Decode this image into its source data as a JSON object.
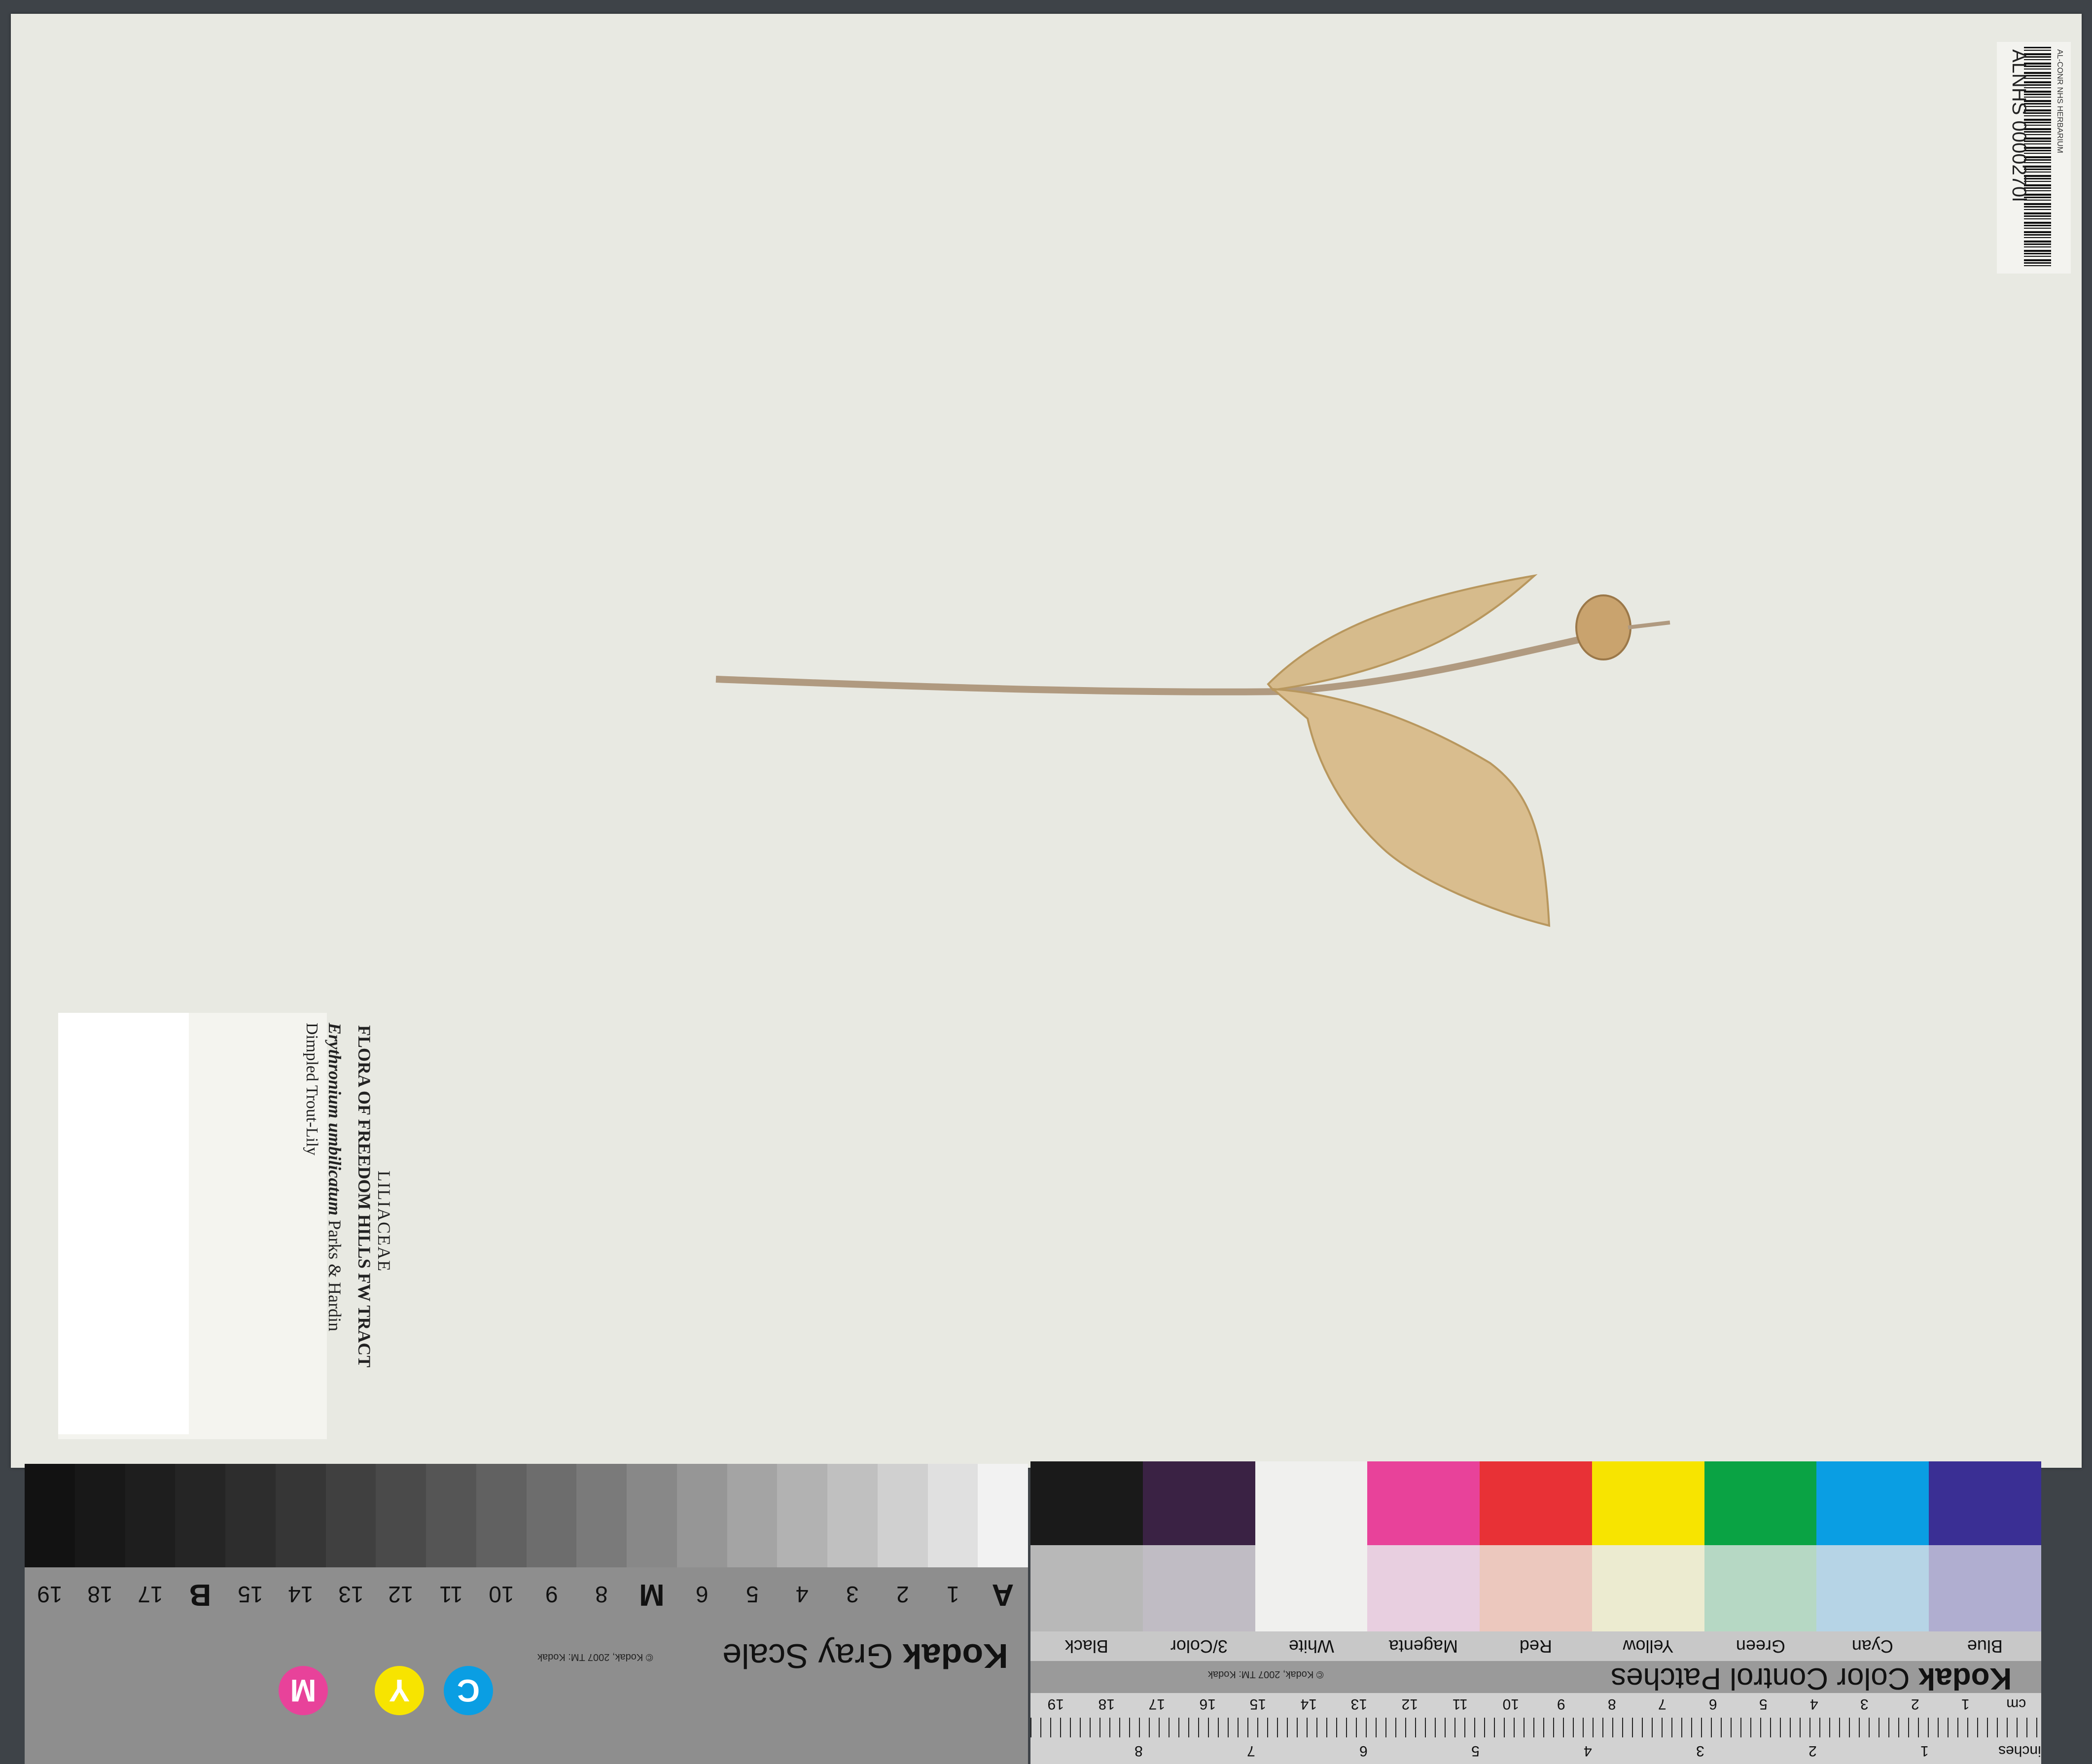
{
  "barcode": {
    "code": "ALNHS 0000270l",
    "institution": "AL-CONR NHS HERBARIUM"
  },
  "label": {
    "family": "LILIACEAE",
    "flora": "FLORA OF FREEDOM HILLS FW TRACT",
    "scientific_name": "Erythronium umbilicatum",
    "authority": "Parks & Hardin",
    "common_name": "Dimpled Trout-Lily"
  },
  "gray_scale": {
    "brand": "Kodak",
    "title": "Gray Scale",
    "copyright": "© Kodak, 2007 TM: Kodak",
    "steps": [
      "A",
      "1",
      "2",
      "3",
      "4",
      "5",
      "6",
      "M",
      "8",
      "9",
      "10",
      "11",
      "12",
      "13",
      "14",
      "15",
      "B",
      "17",
      "18",
      "19"
    ],
    "cym": [
      "C",
      "Y",
      "M"
    ]
  },
  "color_patches": {
    "brand": "Kodak",
    "title": "Color Control Patches",
    "copyright": "© Kodak, 2007 TM: Kodak",
    "names": [
      "Blue",
      "Cyan",
      "Green",
      "Yellow",
      "Red",
      "Magenta",
      "White",
      "3/Color",
      "Black"
    ],
    "cm_label": "cm",
    "inches_label": "inches",
    "cm_numbers": [
      "1",
      "2",
      "3",
      "4",
      "5",
      "6",
      "7",
      "8",
      "9",
      "10",
      "11",
      "12",
      "13",
      "14",
      "15",
      "16",
      "17",
      "18",
      "19"
    ],
    "inch_numbers": [
      "1",
      "2",
      "3",
      "4",
      "5",
      "6",
      "7",
      "8"
    ]
  },
  "colors": {
    "sheet": "#e8e9e2",
    "patches_top": [
      "#3a2f94",
      "#0a9ee3",
      "#0aa344",
      "#f7e400",
      "#e83136",
      "#e8429a",
      "#f0f0ee",
      "#3a2244",
      "#1a1a1a"
    ],
    "patches_bottom": [
      "#b0aed0",
      "#b6d4e6",
      "#b6d8c4",
      "#ecebd0",
      "#ecc8be",
      "#e8cfe0",
      "#f0f0ee",
      "#c0bcc4",
      "#b8b8b8"
    ]
  }
}
